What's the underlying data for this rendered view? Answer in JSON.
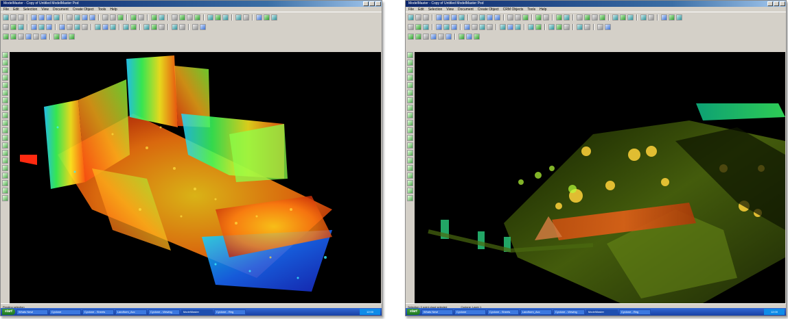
{
  "screens": [
    {
      "window_title": "ModelMaster - Copy of Untitled ModelMaster Pod",
      "menu": [
        "File",
        "Edit",
        "Selection",
        "View",
        "Document",
        "Create Object",
        "Tools",
        "Help"
      ],
      "status_left": "Pending selection",
      "status_right": "",
      "taskbar": {
        "start_label": "start",
        "tasks": [
          "Whats New!",
          "Cyclone",
          "Cyclone - Sheets",
          "Landform_Acc",
          "Cyclone - Viewing",
          "ModelMaster",
          "Cyclone - Reg"
        ],
        "tray": "12:00"
      }
    },
    {
      "window_title": "ModelMaster - Copy of Untitled ModelMaster Pod",
      "menu": [
        "File",
        "Edit",
        "Selection",
        "View",
        "Document",
        "Create Object",
        "CRM Objects",
        "Tools",
        "Help"
      ],
      "status_left": "Selection: 0 point cloud selected",
      "status_right": "Cyclone: Layer 1",
      "taskbar": {
        "start_label": "start",
        "tasks": [
          "Whats New!",
          "Cyclone",
          "Cyclone - Sheets",
          "Landform_Acc",
          "Cyclone - Viewing",
          "ModelMaster",
          "Cyclone - Reg"
        ],
        "tray": "12:00"
      }
    }
  ],
  "toolbar_icons": [
    [
      "cursor-icon",
      "select-icon",
      "lasso-icon",
      "sep",
      "zoom-icon",
      "pan-icon",
      "rotate-icon",
      "fit-icon",
      "sep",
      "front-view-icon",
      "top-view-icon",
      "side-view-icon",
      "iso-view-icon",
      "sep",
      "cloud-icon",
      "mesh-icon",
      "layer-icon",
      "sep",
      "measure-icon",
      "note-icon",
      "sep",
      "grid-icon",
      "axis-icon",
      "sep",
      "box-icon",
      "cylinder-icon",
      "plane-icon",
      "sphere-icon",
      "sep",
      "fence-icon",
      "cut-icon",
      "section-icon",
      "sep",
      "color-icon",
      "light-icon",
      "sep",
      "undo-icon",
      "redo-icon",
      "help-icon"
    ],
    [
      "new-icon",
      "open-icon",
      "save-icon",
      "sep",
      "copy-icon",
      "paste-icon",
      "delete-icon",
      "sep",
      "snap-icon",
      "vertex-icon",
      "edge-icon",
      "face-icon",
      "sep",
      "green-box-icon",
      "green-cylinder-icon",
      "green-plane-icon",
      "sep",
      "group-icon",
      "ungroup-icon",
      "sep",
      "render-icon",
      "wire-icon",
      "shade-icon",
      "sep",
      "export-icon",
      "import-icon",
      "sep",
      "info-icon",
      "settings-icon"
    ],
    [
      "fit-plane-icon",
      "fit-pipe-icon",
      "fit-steel-icon",
      "fit-elbow-icon",
      "fit-tee-icon",
      "fit-reducer-icon",
      "sep",
      "extend-icon",
      "trim-icon",
      "join-icon"
    ]
  ]
}
